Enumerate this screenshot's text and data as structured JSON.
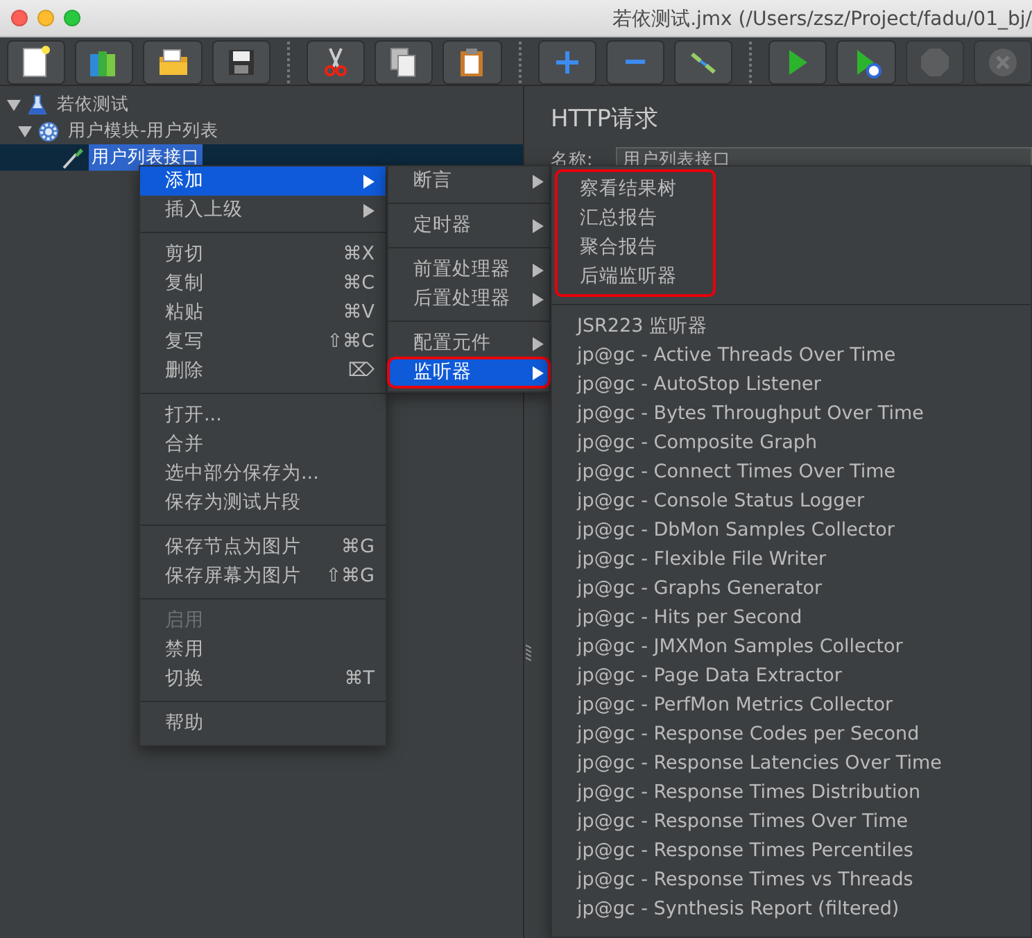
{
  "window": {
    "title": "若依测试.jmx (/Users/zsz/Project/fadu/01_bj/"
  },
  "toolbar": [
    {
      "buttons": [
        {
          "kind": "new",
          "disabled": false
        },
        {
          "kind": "templates",
          "disabled": false
        },
        {
          "kind": "open",
          "disabled": false
        },
        {
          "kind": "save",
          "disabled": false
        }
      ]
    },
    {
      "buttons": [
        {
          "kind": "cut",
          "disabled": false
        },
        {
          "kind": "copy",
          "disabled": false
        },
        {
          "kind": "paste",
          "disabled": false
        }
      ]
    },
    {
      "buttons": [
        {
          "kind": "add",
          "disabled": false
        },
        {
          "kind": "remove",
          "disabled": false
        },
        {
          "kind": "toggle",
          "disabled": false
        }
      ]
    },
    {
      "buttons": [
        {
          "kind": "start",
          "disabled": false
        },
        {
          "kind": "startnopause",
          "disabled": false
        },
        {
          "kind": "stop",
          "disabled": true
        },
        {
          "kind": "shutdown",
          "disabled": true
        }
      ]
    }
  ],
  "tree": [
    {
      "label": "若依测试",
      "kind": "plan",
      "expanded": true,
      "selected": false,
      "children": [
        {
          "label": "用户模块-用户列表",
          "kind": "controller",
          "expanded": true,
          "selected": false,
          "children": [
            {
              "label": "用户列表接口",
              "kind": "sampler",
              "selected": true
            }
          ]
        }
      ]
    }
  ],
  "editor": {
    "title": "HTTP请求",
    "name_label": "名称:",
    "name_value": "用户列表接口"
  },
  "context_menu": [
    {
      "items": [
        {
          "label": "添加",
          "has_submenu": true,
          "selected": true,
          "disabled": false
        },
        {
          "label": "插入上级",
          "has_submenu": true,
          "selected": false,
          "disabled": false
        }
      ]
    },
    {
      "items": [
        {
          "label": "剪切",
          "shortcut": "⌘X",
          "has_submenu": false,
          "selected": false,
          "disabled": false
        },
        {
          "label": "复制",
          "shortcut": "⌘C",
          "has_submenu": false,
          "selected": false,
          "disabled": false
        },
        {
          "label": "粘贴",
          "shortcut": "⌘V",
          "has_submenu": false,
          "selected": false,
          "disabled": false
        },
        {
          "label": "复写",
          "shortcut": "⇧⌘C",
          "has_submenu": false,
          "selected": false,
          "disabled": false
        },
        {
          "label": "删除",
          "shortcut": "⌦",
          "has_submenu": false,
          "selected": false,
          "disabled": false
        }
      ]
    },
    {
      "items": [
        {
          "label": "打开...",
          "has_submenu": false,
          "selected": false,
          "disabled": false
        },
        {
          "label": "合并",
          "has_submenu": false,
          "selected": false,
          "disabled": false
        },
        {
          "label": "选中部分保存为...",
          "has_submenu": false,
          "selected": false,
          "disabled": false
        },
        {
          "label": "保存为测试片段",
          "has_submenu": false,
          "selected": false,
          "disabled": false
        }
      ]
    },
    {
      "items": [
        {
          "label": "保存节点为图片",
          "shortcut": "⌘G",
          "has_submenu": false,
          "selected": false,
          "disabled": false
        },
        {
          "label": "保存屏幕为图片",
          "shortcut": "⇧⌘G",
          "has_submenu": false,
          "selected": false,
          "disabled": false
        }
      ]
    },
    {
      "items": [
        {
          "label": "启用",
          "has_submenu": false,
          "selected": false,
          "disabled": true
        },
        {
          "label": "禁用",
          "has_submenu": false,
          "selected": false,
          "disabled": false
        },
        {
          "label": "切换",
          "shortcut": "⌘T",
          "has_submenu": false,
          "selected": false,
          "disabled": false
        }
      ]
    },
    {
      "items": [
        {
          "label": "帮助",
          "has_submenu": false,
          "selected": false,
          "disabled": false
        }
      ]
    }
  ],
  "add_submenu": [
    {
      "items": [
        {
          "label": "断言",
          "has_submenu": true,
          "selected": false,
          "highlighted": false
        }
      ]
    },
    {
      "items": [
        {
          "label": "定时器",
          "has_submenu": true,
          "selected": false,
          "highlighted": false
        }
      ]
    },
    {
      "items": [
        {
          "label": "前置处理器",
          "has_submenu": true,
          "selected": false,
          "highlighted": false
        },
        {
          "label": "后置处理器",
          "has_submenu": true,
          "selected": false,
          "highlighted": false
        }
      ]
    },
    {
      "items": [
        {
          "label": "配置元件",
          "has_submenu": true,
          "selected": false,
          "highlighted": false
        },
        {
          "label": "监听器",
          "has_submenu": true,
          "selected": true,
          "highlighted": true
        }
      ]
    }
  ],
  "listener_submenu": [
    {
      "highlighted": true,
      "items": [
        "察看结果树",
        "汇总报告",
        "聚合报告",
        "后端监听器"
      ]
    },
    {
      "highlighted": false,
      "items": [
        "JSR223 监听器",
        "jp@gc - Active Threads Over Time",
        "jp@gc - AutoStop Listener",
        "jp@gc - Bytes Throughput Over Time",
        "jp@gc - Composite Graph",
        "jp@gc - Connect Times Over Time",
        "jp@gc - Console Status Logger",
        "jp@gc - DbMon Samples Collector",
        "jp@gc - Flexible File Writer",
        "jp@gc - Graphs Generator",
        "jp@gc - Hits per Second",
        "jp@gc - JMXMon Samples Collector",
        "jp@gc - Page Data Extractor",
        "jp@gc - PerfMon Metrics Collector",
        "jp@gc - Response Codes per Second",
        "jp@gc - Response Latencies Over Time",
        "jp@gc - Response Times Distribution",
        "jp@gc - Response Times Over Time",
        "jp@gc - Response Times Percentiles",
        "jp@gc - Response Times vs Threads",
        "jp@gc - Synthesis Report (filtered)"
      ]
    }
  ]
}
